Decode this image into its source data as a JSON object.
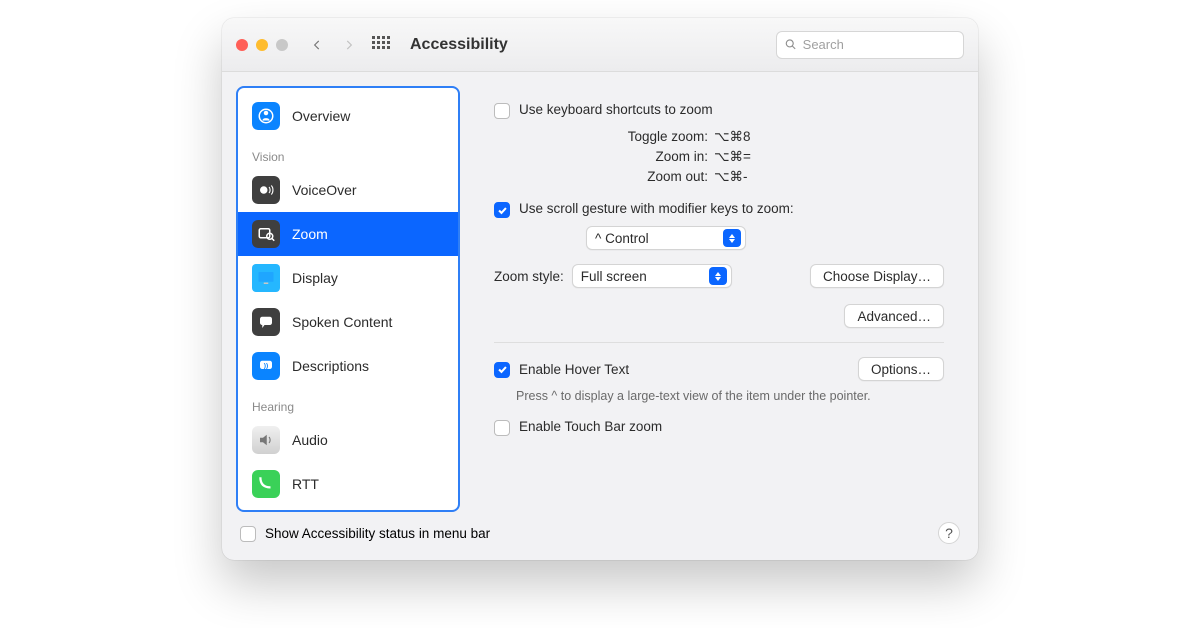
{
  "toolbar": {
    "title": "Accessibility",
    "search_placeholder": "Search"
  },
  "sidebar": {
    "overview": "Overview",
    "section_vision": "Vision",
    "voiceover": "VoiceOver",
    "zoom": "Zoom",
    "display": "Display",
    "spoken": "Spoken Content",
    "descriptions": "Descriptions",
    "section_hearing": "Hearing",
    "audio": "Audio",
    "rtt": "RTT"
  },
  "main": {
    "use_keyboard": "Use keyboard shortcuts to zoom",
    "shortcuts": {
      "toggle_label": "Toggle zoom:",
      "toggle_keys": "⌥⌘8",
      "in_label": "Zoom in:",
      "in_keys": "⌥⌘=",
      "out_label": "Zoom out:",
      "out_keys": "⌥⌘-"
    },
    "use_scroll": "Use scroll gesture with modifier keys to zoom:",
    "modifier_value": "^ Control",
    "zoom_style_label": "Zoom style:",
    "zoom_style_value": "Full screen",
    "choose_display": "Choose Display…",
    "advanced": "Advanced…",
    "hover_text": "Enable Hover Text",
    "options": "Options…",
    "hint": "Press ^ to display a large-text view of the item under the pointer.",
    "touch_bar": "Enable Touch Bar zoom"
  },
  "footer": {
    "status": "Show Accessibility status in menu bar",
    "help": "?"
  }
}
